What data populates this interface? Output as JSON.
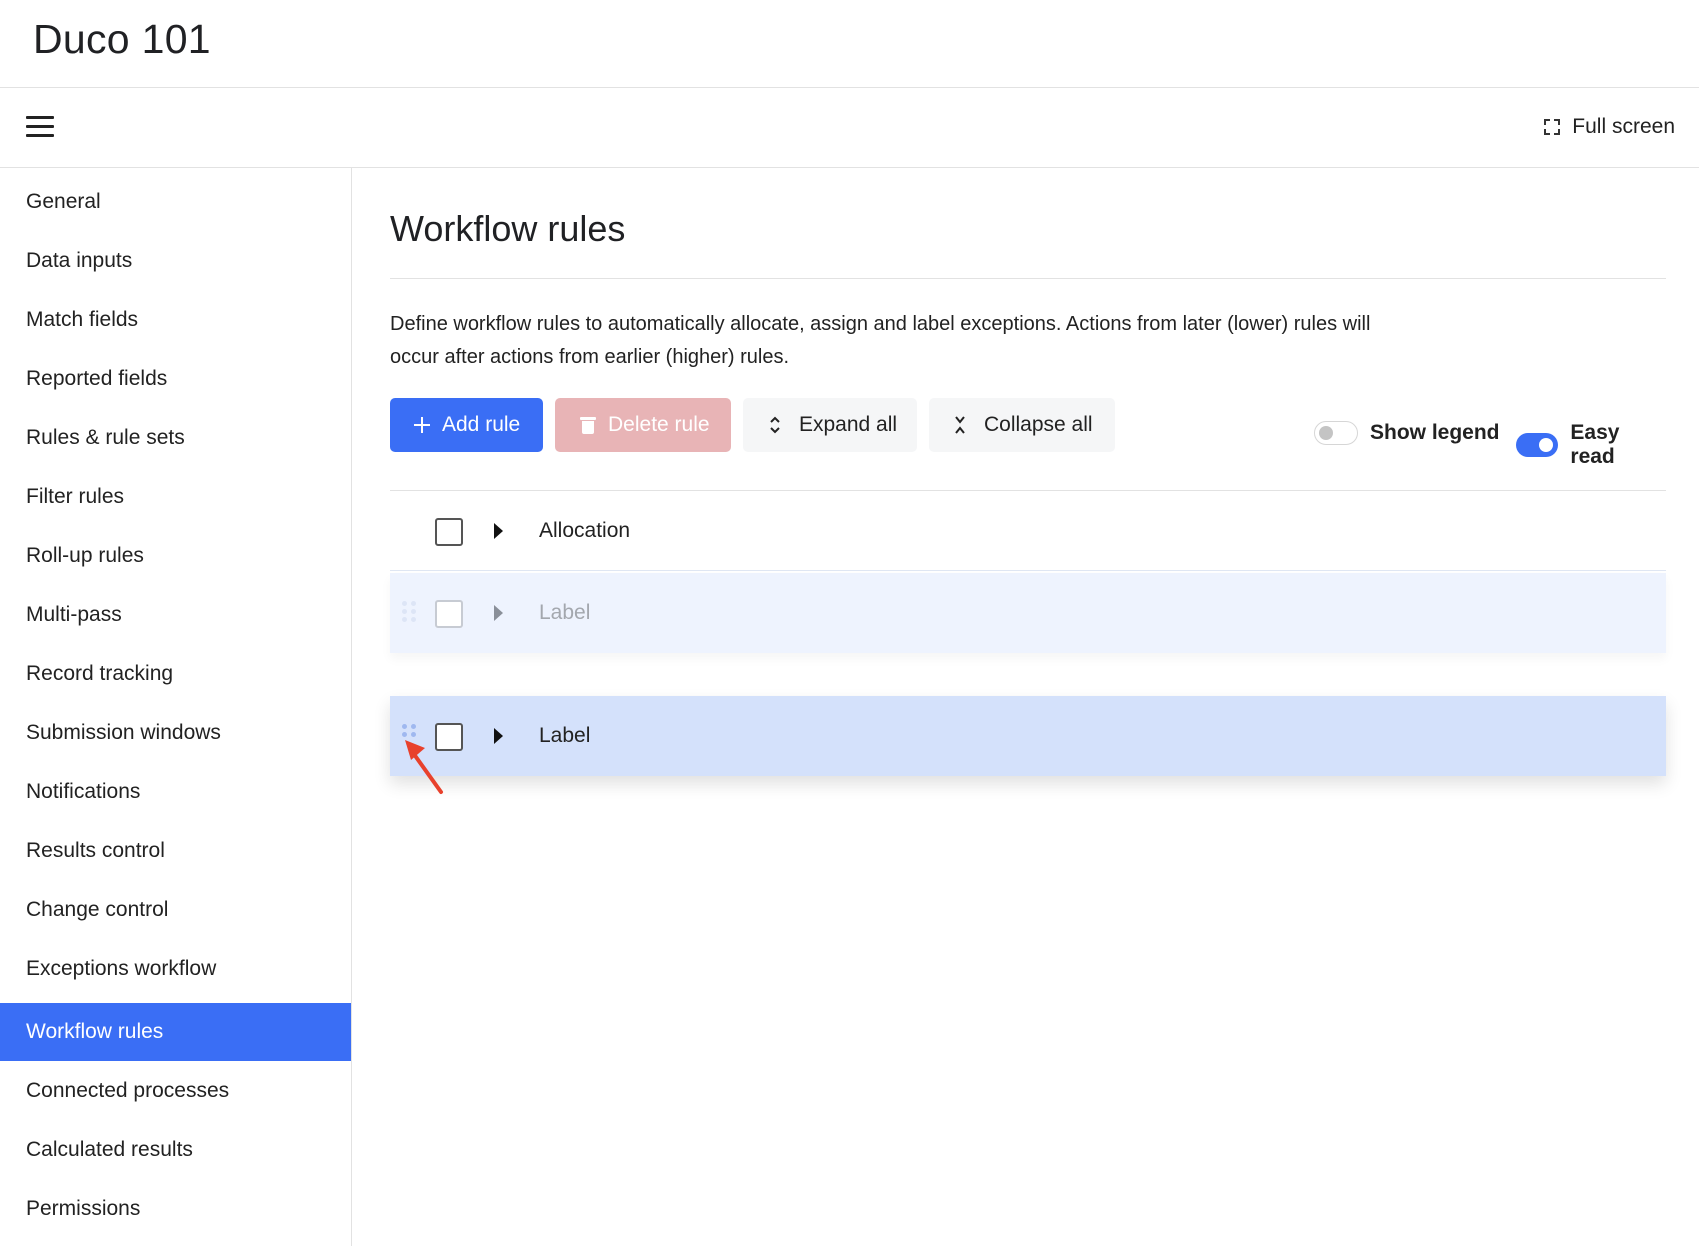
{
  "app": {
    "title": "Duco 101"
  },
  "toolbar": {
    "fullscreen_label": "Full screen",
    "menu_icon": "hamburger-menu-icon",
    "fullscreen_icon": "fullscreen-icon"
  },
  "sidebar": {
    "items": [
      {
        "label": "General"
      },
      {
        "label": "Data inputs"
      },
      {
        "label": "Match fields"
      },
      {
        "label": "Reported fields"
      },
      {
        "label": "Rules & rule sets"
      },
      {
        "label": "Filter rules"
      },
      {
        "label": "Roll-up rules"
      },
      {
        "label": "Multi-pass"
      },
      {
        "label": "Record tracking"
      },
      {
        "label": "Submission windows"
      },
      {
        "label": "Notifications"
      },
      {
        "label": "Results control"
      },
      {
        "label": "Change control"
      },
      {
        "label": "Exceptions workflow"
      },
      {
        "label": "Workflow rules",
        "active": true
      },
      {
        "label": "Connected processes"
      },
      {
        "label": "Calculated results"
      },
      {
        "label": "Permissions"
      }
    ]
  },
  "main": {
    "title": "Workflow rules",
    "description": "Define workflow rules to automatically allocate, assign and label exceptions. Actions from later (lower) rules will occur after actions from earlier (higher) rules.",
    "buttons": {
      "add": "Add rule",
      "delete": "Delete rule",
      "expand": "Expand all",
      "collapse": "Collapse all"
    },
    "toggles": {
      "show_legend": {
        "label": "Show legend",
        "on": false
      },
      "easy_read": {
        "label": "Easy read",
        "on": true
      }
    },
    "rules": [
      {
        "label": "Allocation",
        "state": "normal"
      },
      {
        "label": "Label",
        "state": "drop-placeholder"
      },
      {
        "label": "Label",
        "state": "dragging"
      }
    ]
  },
  "colors": {
    "accent": "#3a6ef5",
    "delete_disabled": "#e8b4b6",
    "drag_row": "#d4e1fb",
    "placeholder_row": "#eef3fe",
    "annotation_arrow": "#e8412c"
  }
}
